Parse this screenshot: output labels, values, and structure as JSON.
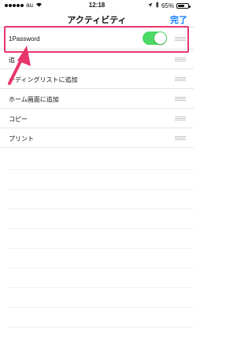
{
  "status_bar": {
    "carrier": "au",
    "time": "12:18",
    "battery_percent": "65%",
    "battery_level": 0.65
  },
  "nav": {
    "title": "アクティビティ",
    "done_label": "完了"
  },
  "activities": [
    {
      "label": "1Password",
      "toggle_on": true
    },
    {
      "label": "追"
    },
    {
      "label": "ーディングリストに追加"
    },
    {
      "label": "ホーム画面に追加"
    },
    {
      "label": "コピー"
    },
    {
      "label": "プリント"
    }
  ],
  "colors": {
    "accent": "#0a7cff",
    "toggle_on": "#4cd964",
    "highlight": "#e6366a"
  }
}
